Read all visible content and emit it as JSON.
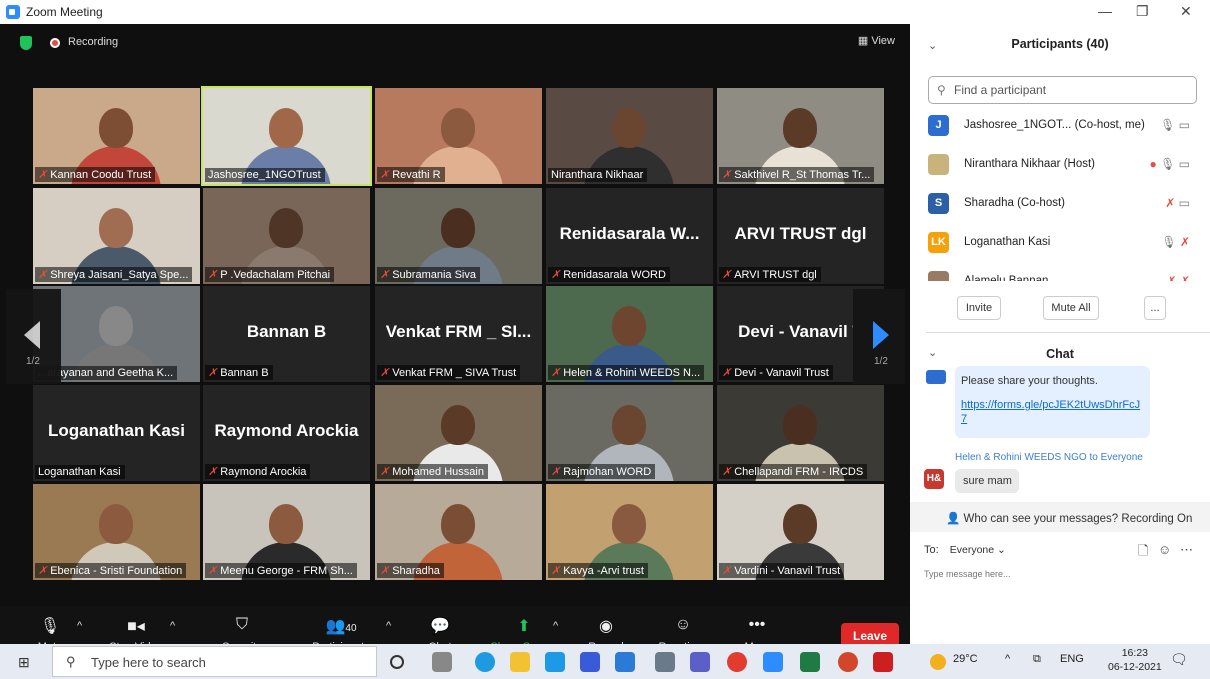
{
  "window": {
    "title": "Zoom Meeting",
    "min": "—",
    "max": "❐",
    "close": "✕"
  },
  "topbar": {
    "recording": "Recording",
    "view": "View",
    "view_icon": "grid-icon"
  },
  "tiles": [
    {
      "label": "Kannan Coodu Trust",
      "muted": true,
      "type": "video",
      "bg": "#c9a98a",
      "skin": "#7d4e34",
      "shirt": "#c2473a"
    },
    {
      "label": "Jashosree_1NGOTrust",
      "muted": false,
      "type": "video",
      "active": true,
      "bg": "#d9d9cf",
      "skin": "#a06848",
      "shirt": "#6a7ea8"
    },
    {
      "label": "Revathi R",
      "muted": true,
      "type": "video",
      "bg": "#b87a5e",
      "skin": "#8c5a3e",
      "shirt": "#e0b090"
    },
    {
      "label": "Niranthara Nikhaar",
      "muted": false,
      "type": "video",
      "bg": "#5a4a44",
      "skin": "#6a4530",
      "shirt": "#2f2f2f"
    },
    {
      "label": "Sakthivel R_St Thomas Tr...",
      "muted": true,
      "type": "video",
      "bg": "#8f8c84",
      "skin": "#5b3a28",
      "shirt": "#e8e2d6"
    },
    {
      "label": "Shreya Jaisani_Satya Spe...",
      "muted": true,
      "type": "video",
      "bg": "#d6cec2",
      "skin": "#a06c52",
      "shirt": "#4a5a6a"
    },
    {
      "label": "P .Vedachalam Pitchai",
      "muted": true,
      "type": "video",
      "bg": "#7a6658",
      "skin": "#4e3526",
      "shirt": "#8a7a6e"
    },
    {
      "label": "Subramania Siva",
      "muted": true,
      "type": "video",
      "bg": "#6c6a5e",
      "skin": "#4a2f21",
      "shirt": "#6f7c88"
    },
    {
      "label": "Renidasarala WORD",
      "muted": true,
      "type": "name",
      "big": "Renidasarala  W..."
    },
    {
      "label": "ARVI TRUST dgl",
      "muted": true,
      "type": "name",
      "big": "ARVI TRUST dgl"
    },
    {
      "label": "...arayanan and Geetha K...",
      "muted": false,
      "type": "video",
      "bg": "#6e7478",
      "skin": "#888",
      "shirt": "#777"
    },
    {
      "label": "Bannan B",
      "muted": true,
      "type": "name",
      "big": "Bannan B"
    },
    {
      "label": "Venkat FRM _ SIVA Trust",
      "muted": true,
      "type": "name",
      "big": "Venkat FRM _ SI..."
    },
    {
      "label": "Helen & Rohini WEEDS N...",
      "muted": true,
      "type": "video",
      "bg": "#4e6a4e",
      "skin": "#6e452e",
      "shirt": "#3a5a8a"
    },
    {
      "label": "Devi - Vanavil Trust",
      "muted": true,
      "type": "name",
      "big": "Devi - Vanavil T"
    },
    {
      "label": "Loganathan Kasi",
      "muted": false,
      "type": "name",
      "big": "Loganathan Kasi"
    },
    {
      "label": "Raymond Arockia",
      "muted": true,
      "type": "name",
      "big": "Raymond Arockia"
    },
    {
      "label": "Mohamed Hussain",
      "muted": true,
      "type": "video",
      "bg": "#7a6a58",
      "skin": "#5c3a28",
      "shirt": "#e9e9e9"
    },
    {
      "label": "Rajmohan WORD",
      "muted": true,
      "type": "video",
      "bg": "#6a6a62",
      "skin": "#6a4530",
      "shirt": "#b0b6bc"
    },
    {
      "label": "Chellapandi FRM - IRCDS",
      "muted": true,
      "type": "video",
      "bg": "#3c3a34",
      "skin": "#4a2f21",
      "shirt": "#c9c2ae"
    },
    {
      "label": "Ebenica - Sristi Foundation",
      "muted": true,
      "type": "video",
      "bg": "#9a7a52",
      "skin": "#8c5a3e",
      "shirt": "#d0c8b8"
    },
    {
      "label": "Meenu George - FRM Sh...",
      "muted": true,
      "type": "video",
      "bg": "#c8c4bc",
      "skin": "#8c5a3e",
      "shirt": "#2a2a2a"
    },
    {
      "label": "Sharadha",
      "muted": true,
      "type": "video",
      "bg": "#b8aa98",
      "skin": "#7a4e34",
      "shirt": "#c2643a"
    },
    {
      "label": "Kavya -Arvi trust",
      "muted": true,
      "type": "video",
      "bg": "#c2a070",
      "skin": "#8a5a40",
      "shirt": "#5a7a5a"
    },
    {
      "label": "Vardini - Vanavil Trust",
      "muted": true,
      "type": "video",
      "bg": "#d4d0c8",
      "skin": "#5c3a28",
      "shirt": "#3a3a3a"
    }
  ],
  "pagination": {
    "left": "1/2",
    "right": "1/2"
  },
  "toolbar": {
    "mute": "Mute",
    "stop_video": "Stop Video",
    "security": "Security",
    "participants": "Participants",
    "participants_count": "40",
    "chat": "Chat",
    "share_screen": "Share Screen",
    "record": "Record",
    "reactions": "Reactions",
    "more": "More",
    "leave": "Leave"
  },
  "participants": {
    "title": "Participants (40)",
    "search_placeholder": "Find a participant",
    "list": [
      {
        "initials": "J",
        "name": "Jashosree_1NGOT... (Co-host, me)",
        "color": "#2d6dd1"
      },
      {
        "initials": "",
        "name": "Niranthara Nikhaar (Host)",
        "color": "#c8b37a"
      },
      {
        "initials": "S",
        "name": "Sharadha (Co-host)",
        "color": "#2b5fa8"
      },
      {
        "initials": "LK",
        "name": "Loganathan Kasi",
        "color": "#f5a10a"
      },
      {
        "initials": "",
        "name": "Alamelu Bannan",
        "color": "#9a7a62"
      }
    ],
    "invite": "Invite",
    "mute_all": "Mute All",
    "more": "..."
  },
  "chat": {
    "title": "Chat",
    "message1_text": "Please share your thoughts.",
    "message1_link": "https://forms.gle/pcJEK2tUwsDhrFcJ7",
    "sender2": "Helen & Rohini WEEDS NGO to Everyone",
    "sender2_initials": "H&",
    "message2": "sure mam",
    "privacy": "Who can see your messages? Recording On",
    "to_label": "To:",
    "to_value": "Everyone",
    "placeholder": "Type message here..."
  },
  "taskbar": {
    "search": "Type here to search",
    "weather": "29°C",
    "lang": "ENG",
    "time": "16:23",
    "date": "06-12-2021"
  }
}
